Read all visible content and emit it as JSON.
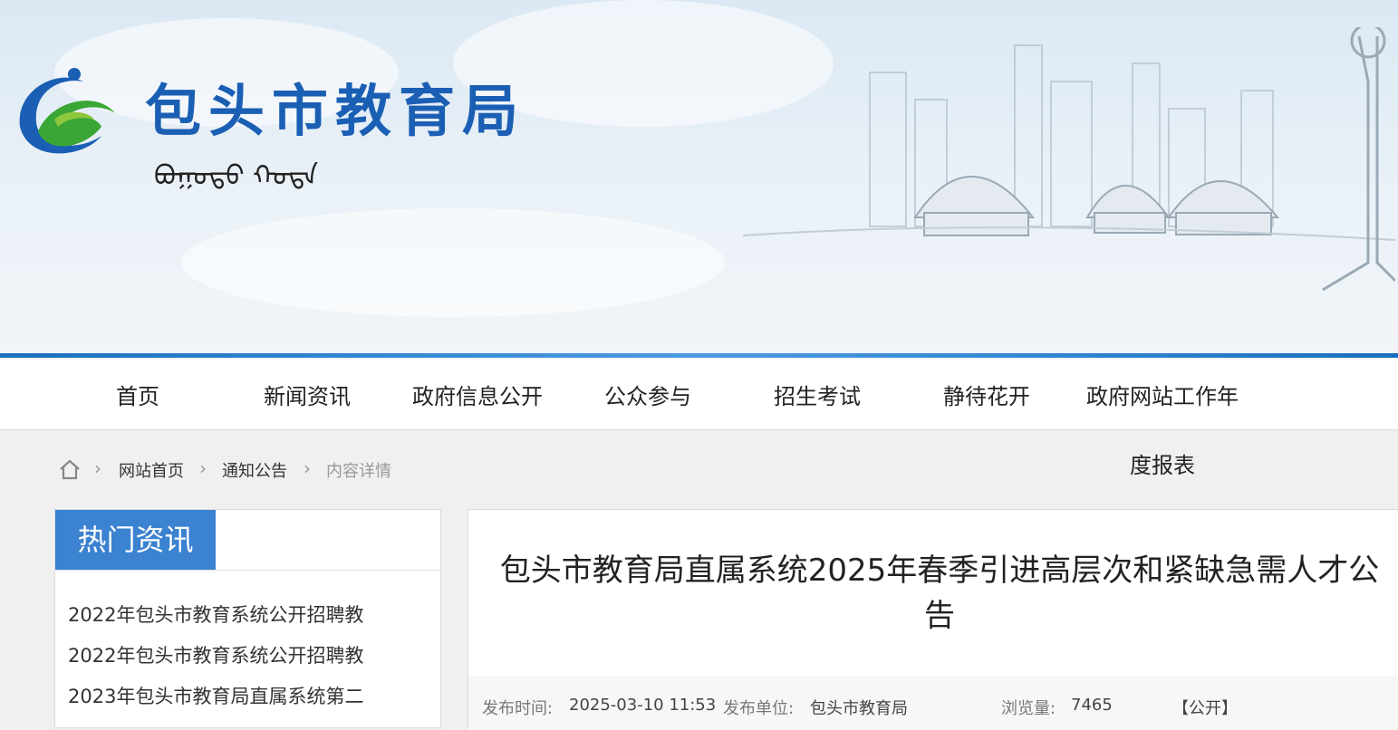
{
  "header": {
    "site_title": "包头市教育局",
    "mongolian_script": "ᠪᠣᠭᠣᠲᠣ ᠬᠣᠲᠠ"
  },
  "nav": {
    "items": [
      "首页",
      "新闻资讯",
      "政府信息公开",
      "公众参与",
      "招生考试",
      "静待花开"
    ],
    "wrap_line1": "政府网站工作年",
    "wrap_line2": "度报表"
  },
  "breadcrumb": {
    "home": "网站首页",
    "section": "通知公告",
    "current": "内容详情"
  },
  "hot_news": {
    "heading": "热门资讯",
    "items": [
      "2022年包头市教育系统公开招聘教",
      "2022年包头市教育系统公开招聘教",
      "2023年包头市教育局直属系统第二"
    ]
  },
  "article": {
    "title": "包头市教育局直属系统2025年春季引进高层次和紧缺急需人才公告",
    "publish_time_label": "发布时间:",
    "publish_time": "2025-03-10 11:53",
    "publisher_label": "发布单位:",
    "publisher": "包头市教育局",
    "views_label": "浏览量:",
    "views": "7465",
    "status": "【公开】"
  },
  "colors": {
    "brand_blue": "#1a5fb4",
    "accent_blue": "#3b82d0"
  }
}
